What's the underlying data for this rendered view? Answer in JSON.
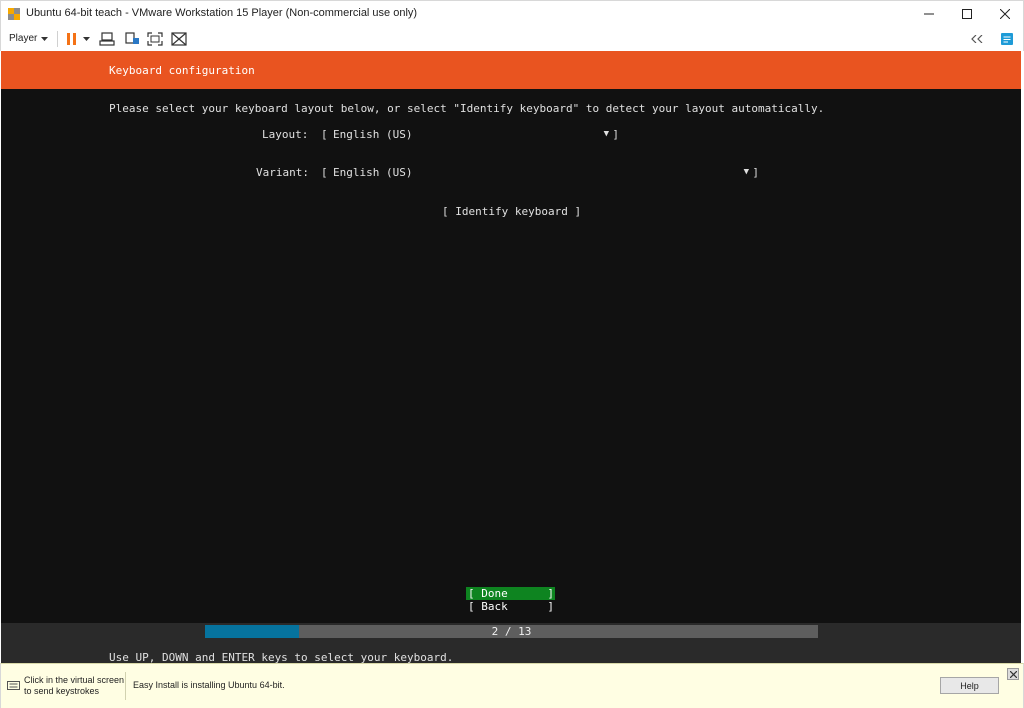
{
  "window": {
    "title": "Ubuntu 64-bit teach - VMware Workstation 15 Player (Non-commercial use only)",
    "icons": [
      "vmware-player-icon",
      "minimize-icon",
      "maximize-icon",
      "close-icon"
    ]
  },
  "toolbar": {
    "player_label": "Player",
    "icons": [
      "dropdown-arrow-icon",
      "pause-icon",
      "send-ctrl-alt-del-icon",
      "removable-devices-icon",
      "full-screen-icon",
      "unity-icon",
      "collapse-icon",
      "library-icon"
    ]
  },
  "guest": {
    "header_title": "Keyboard configuration",
    "instructions": "Please select your keyboard layout below, or select \"Identify keyboard\" to detect your layout automatically.",
    "layout": {
      "label": "Layout:",
      "value": "English (US)",
      "open_bracket": "[",
      "close_bracket": "]",
      "arrow": "▼"
    },
    "variant": {
      "label": "Variant:",
      "value": "English (US)",
      "open_bracket": "[",
      "close_bracket": "]",
      "arrow": "▼"
    },
    "identify_button": "[ Identify keyboard ]",
    "done_button": {
      "open": "[ Done",
      "close": "]"
    },
    "back_button": {
      "open": "[ Back",
      "close": "]"
    },
    "progress": {
      "text": "2 / 13",
      "current": 2,
      "total": 13
    },
    "hint": "Use UP, DOWN and ENTER keys to select your keyboard."
  },
  "statusbar": {
    "hint_line1": "Click in the virtual screen",
    "hint_line2": "to send keystrokes",
    "message": "Easy Install is installing Ubuntu 64-bit.",
    "help_label": "Help"
  },
  "colors": {
    "ubuntu_orange": "#e95420",
    "done_green": "#0e8420",
    "progress_blue": "#06739e",
    "pause_orange": "#f47216",
    "statusbar_yellow": "#fffee3"
  }
}
